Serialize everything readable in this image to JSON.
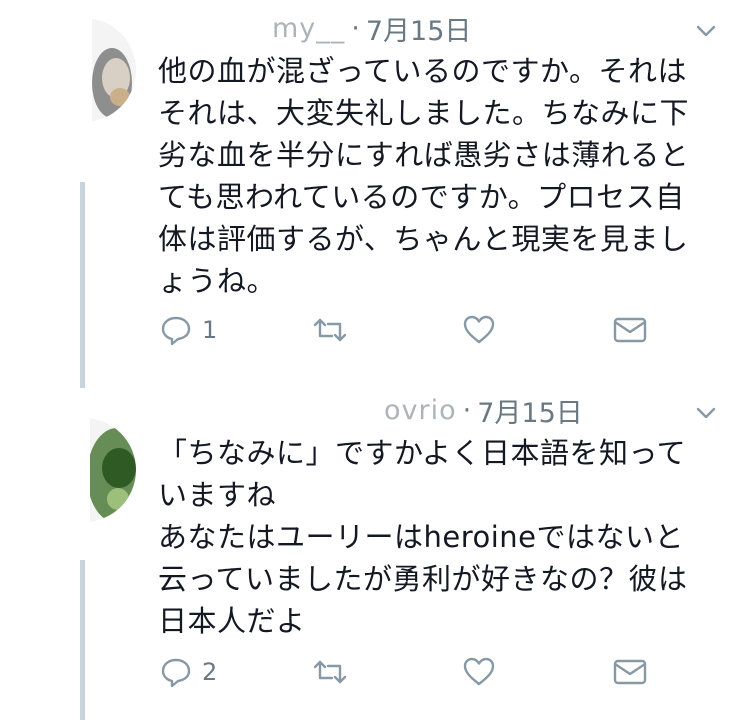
{
  "colors": {
    "meta_gray": "#697882",
    "icon_gray": "#8899a6",
    "text": "#141823",
    "thread_line": "#c8d3dc"
  },
  "tweets": [
    {
      "name_fragment": "my__",
      "separator": "·",
      "date": "7月15日",
      "lines": [
        "他の血が混ざっているのですか。それは",
        "それは、大変失礼しました。ちなみに下",
        "劣な血を半分にすれば愚劣さは薄れると",
        "ても思われているのですか。プロセス自",
        "体は評価するが、ちゃんと現実を見まし",
        "ょうね。"
      ],
      "reply_count": "1",
      "icons": [
        "reply-icon",
        "retweet-icon",
        "like-icon",
        "direct-message-icon",
        "chevron-down-icon"
      ]
    },
    {
      "name_fragment": "ovrio",
      "separator": "·",
      "date": "7月15日",
      "lines": [
        "「ちなみに」ですかよく日本語を知って",
        "いますね",
        "あなたはユーリーはheroineではないと",
        "云っていましたが勇利が好きなの？彼は",
        "日本人だよ"
      ],
      "reply_count": "2",
      "icons": [
        "reply-icon",
        "retweet-icon",
        "like-icon",
        "direct-message-icon",
        "chevron-down-icon"
      ]
    }
  ]
}
